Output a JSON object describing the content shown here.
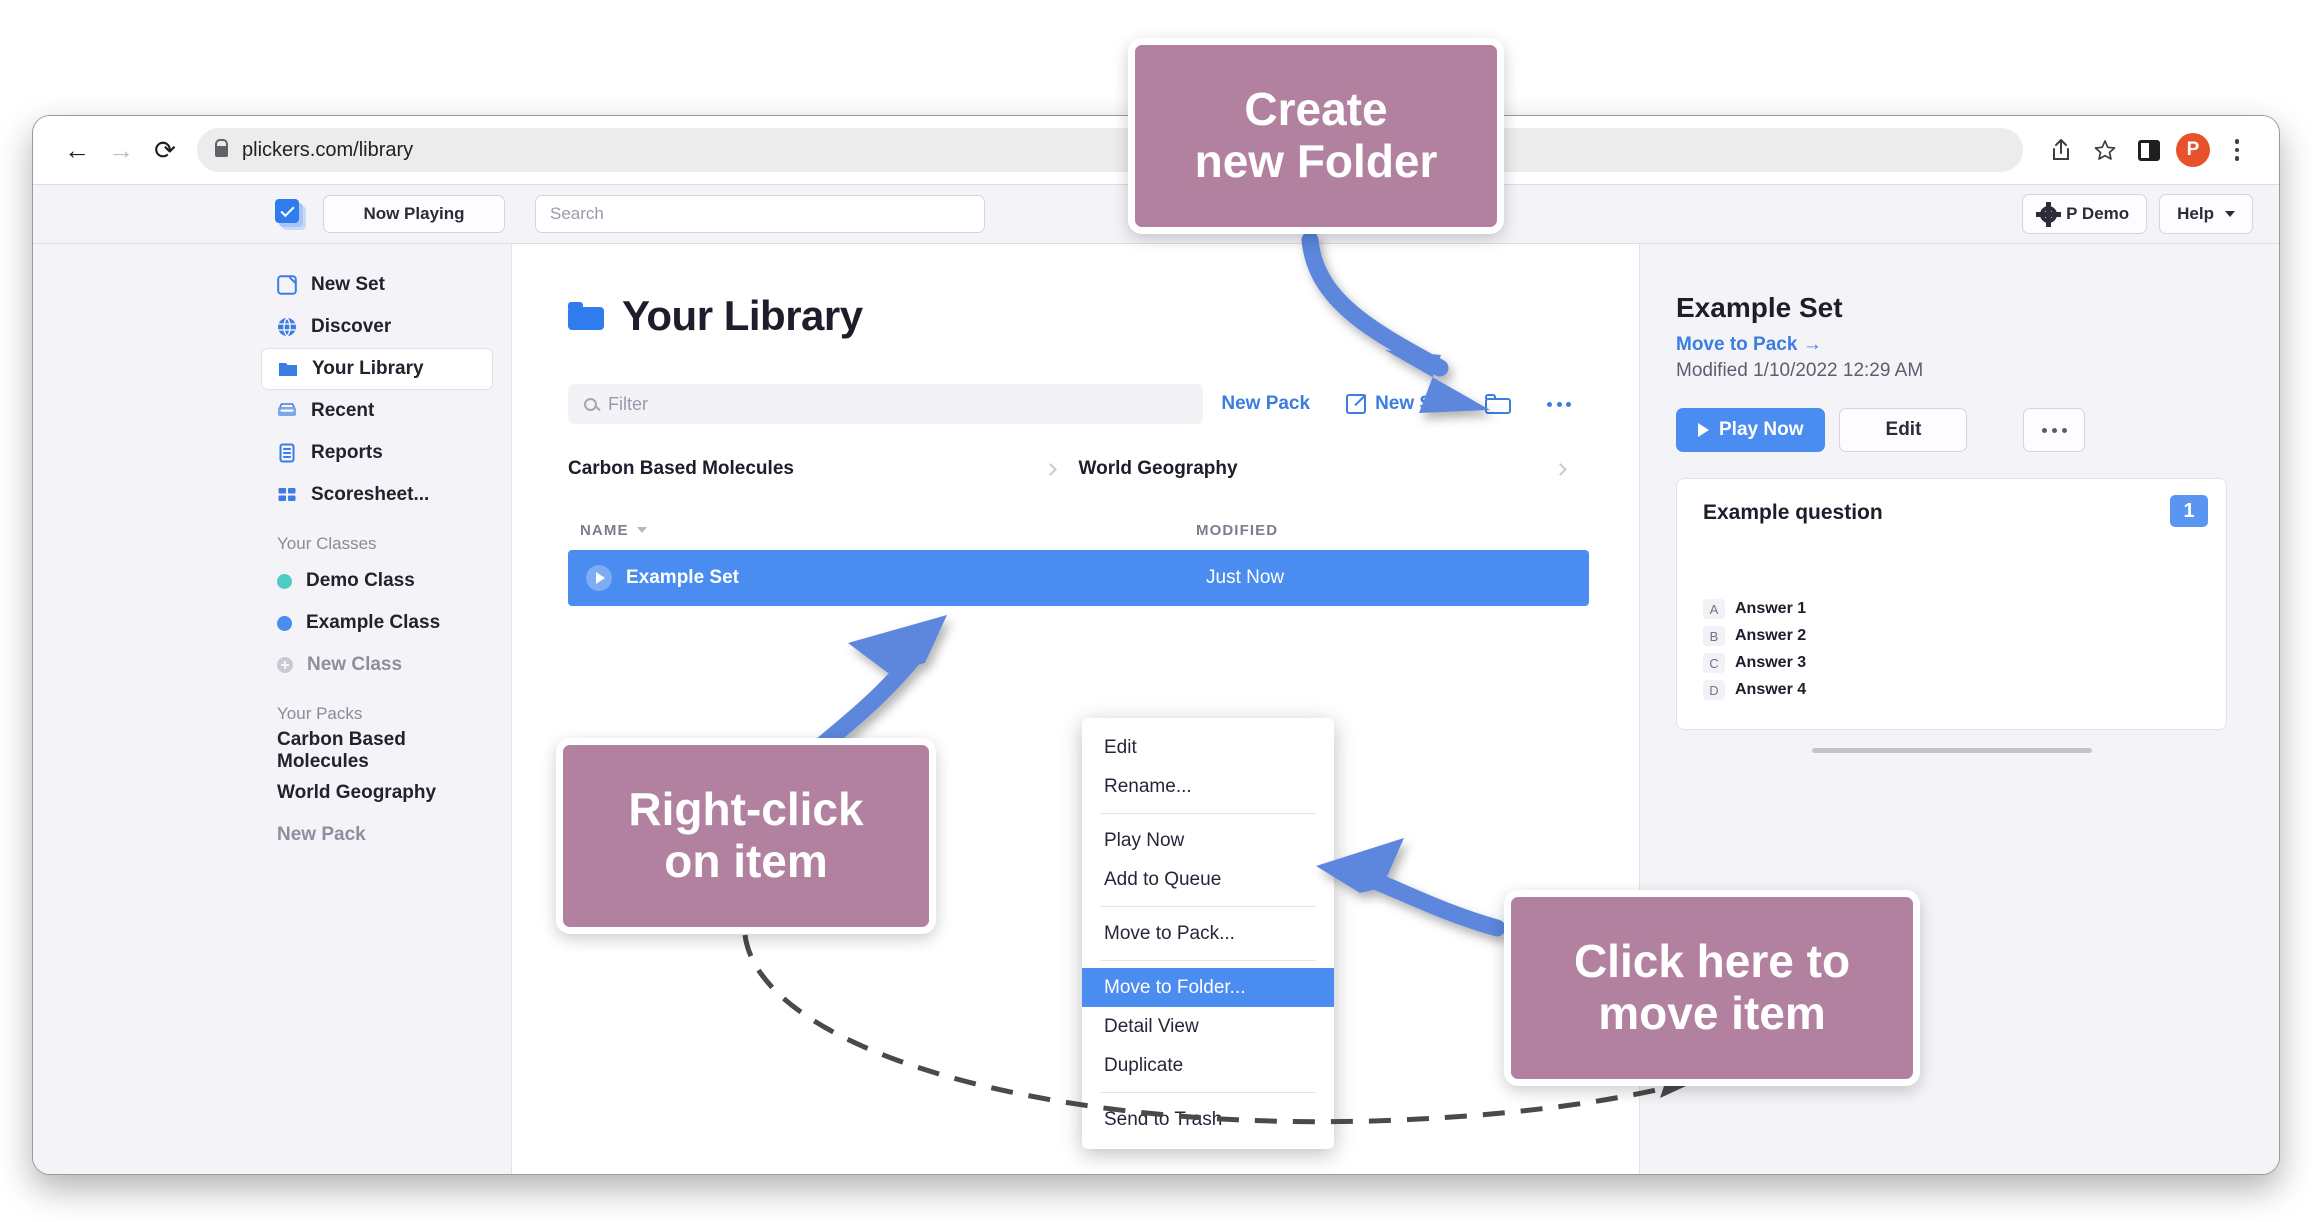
{
  "browser": {
    "url": "plickers.com/library",
    "back_icon": "back-arrow-icon",
    "forward_icon": "forward-arrow-icon",
    "reload_icon": "reload-icon",
    "lock_icon": "lock-icon",
    "share_icon": "share-icon",
    "bookmark_icon": "star-icon",
    "side_panel_icon": "side-panel-icon",
    "profile_initial": "P",
    "menu_icon": "kebab-menu-icon"
  },
  "header": {
    "logo_name": "plickers-logo",
    "now_playing": "Now Playing",
    "search_placeholder": "Search",
    "account": "P Demo",
    "help": "Help"
  },
  "sidebar": {
    "items": [
      {
        "label": "New Set",
        "icon": "new-set-icon",
        "state": "normal"
      },
      {
        "label": "Discover",
        "icon": "globe-icon",
        "state": "normal"
      },
      {
        "label": "Your Library",
        "icon": "folder-icon",
        "state": "active"
      },
      {
        "label": "Recent",
        "icon": "inbox-icon",
        "state": "normal"
      },
      {
        "label": "Reports",
        "icon": "report-icon",
        "state": "normal"
      },
      {
        "label": "Scoresheet...",
        "icon": "grid-icon",
        "state": "normal"
      }
    ],
    "classes_heading": "Your Classes",
    "classes": [
      {
        "label": "Demo Class",
        "color": "#4ecdc4",
        "state": "normal"
      },
      {
        "label": "Example Class",
        "color": "#4a8cf0",
        "state": "normal"
      },
      {
        "label": "New Class",
        "color": "#c9c9d4",
        "state": "muted"
      }
    ],
    "packs_heading": "Your Packs",
    "packs": [
      {
        "label": "Carbon Based Molecules",
        "state": "normal"
      },
      {
        "label": "World Geography",
        "state": "normal"
      },
      {
        "label": "New Pack",
        "state": "muted"
      }
    ]
  },
  "main": {
    "title": "Your Library",
    "title_icon": "folder-icon",
    "filter_placeholder": "Filter",
    "filter_icon": "search-icon",
    "actions": [
      {
        "label": "New Pack",
        "icon": ""
      },
      {
        "label": "New Set",
        "icon": "new-set-icon"
      }
    ],
    "new_folder_icon": "folder-icon",
    "more_icon": "more-horizontal-icon",
    "packs": [
      "Carbon Based Molecules",
      "World Geography"
    ],
    "columns": {
      "name": "NAME",
      "modified": "MODIFIED"
    },
    "sort_icon": "chevron-down-icon",
    "rows": [
      {
        "name": "Example Set",
        "modified": "Just Now",
        "selected": true,
        "icon": "play-icon"
      }
    ]
  },
  "detail": {
    "title": "Example Set",
    "move_link": "Move to Pack →",
    "modified": "Modified 1/10/2022 12:29 AM",
    "play_label": "Play Now",
    "play_icon": "play-icon",
    "edit_label": "Edit",
    "more_icon": "more-horizontal-icon",
    "question": {
      "text": "Example question",
      "number": "1",
      "answers": [
        {
          "key": "A",
          "text": "Answer 1"
        },
        {
          "key": "B",
          "text": "Answer 2"
        },
        {
          "key": "C",
          "text": "Answer 3"
        },
        {
          "key": "D",
          "text": "Answer 4"
        }
      ]
    }
  },
  "context_menu": {
    "groups": [
      [
        {
          "label": "Edit",
          "highlighted": false
        },
        {
          "label": "Rename...",
          "highlighted": false
        }
      ],
      [
        {
          "label": "Play Now",
          "highlighted": false
        },
        {
          "label": "Add to Queue",
          "highlighted": false
        }
      ],
      [
        {
          "label": "Move to Pack...",
          "highlighted": false
        }
      ],
      [
        {
          "label": "Move to Folder...",
          "highlighted": true
        },
        {
          "label": "Detail View",
          "highlighted": false
        },
        {
          "label": "Duplicate",
          "highlighted": false
        }
      ],
      [
        {
          "label": "Send to Trash",
          "highlighted": false
        }
      ]
    ]
  },
  "annotations": {
    "box_color": "#b2819f",
    "arrow_color": "#5b87dd",
    "dashed_color": "#4a4a4a",
    "callouts": [
      {
        "id": "create",
        "text": "Create\nnew Folder"
      },
      {
        "id": "rightclick",
        "text": "Right-click\non item"
      },
      {
        "id": "click",
        "text": "Click here to\nmove item"
      }
    ]
  }
}
